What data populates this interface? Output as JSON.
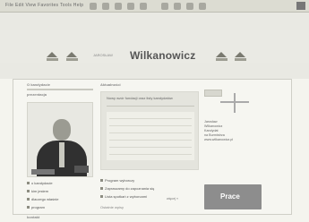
{
  "browser": {
    "menu": "File  Edit  View  Favorites  Tools  Help"
  },
  "header": {
    "brand": "Wilkanowicz",
    "small_text": "JAROSŁAW"
  },
  "left": {
    "heading": "O kandydacie",
    "subheading": "prezentacja",
    "links": [
      "o kandydacie",
      "kim jestem",
      "dlaczego właśnie",
      "program"
    ],
    "section2": "kontakt"
  },
  "main": {
    "heading": "Aktualności",
    "article_title": "Nowy wzór fundacji oraz listy kandydatów",
    "news": [
      "Program wyborczy",
      "Zapraszamy do zapoznania się",
      "Lista spotkań z wyborcami"
    ],
    "more": "więcej »",
    "bottom": "Ostatnie wpisy"
  },
  "right": {
    "heading": "Oświata",
    "info": "Jarosław\nWilkanowicz\nKandydat\nna Burmistrza\nwww.wilkanowicz.pl",
    "button": "Prace"
  }
}
